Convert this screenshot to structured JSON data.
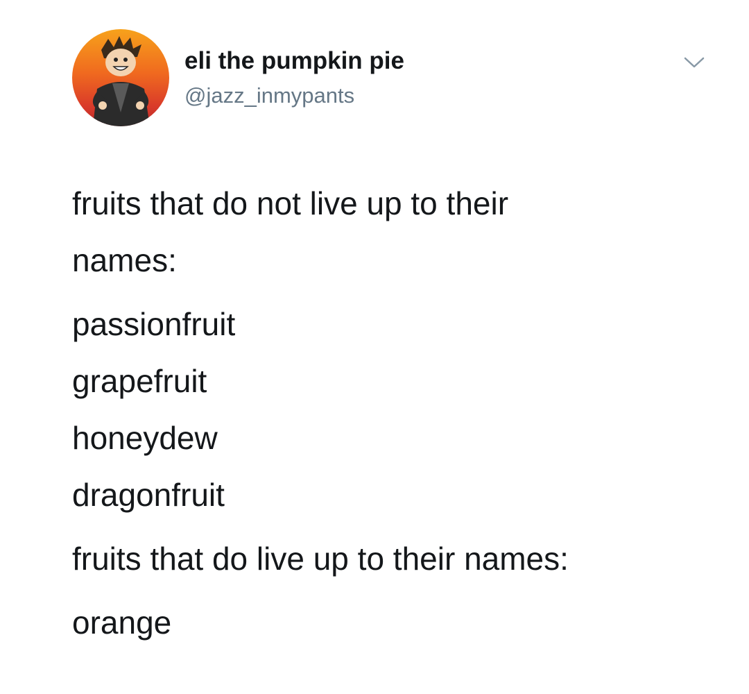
{
  "tweet": {
    "author": {
      "display_name": "eli the pumpkin pie",
      "handle": "@jazz_inmypants",
      "avatar_icon": "cartoon-character-avatar"
    },
    "menu_icon": "chevron-down-icon",
    "text": {
      "intro_line_1": "fruits that do not live up to their",
      "intro_line_2": "names:",
      "list_1": [
        "passionfruit",
        "grapefruit",
        "honeydew",
        "dragonfruit"
      ],
      "outro": "fruits that do live up to their names:",
      "list_2": [
        "orange"
      ]
    }
  }
}
